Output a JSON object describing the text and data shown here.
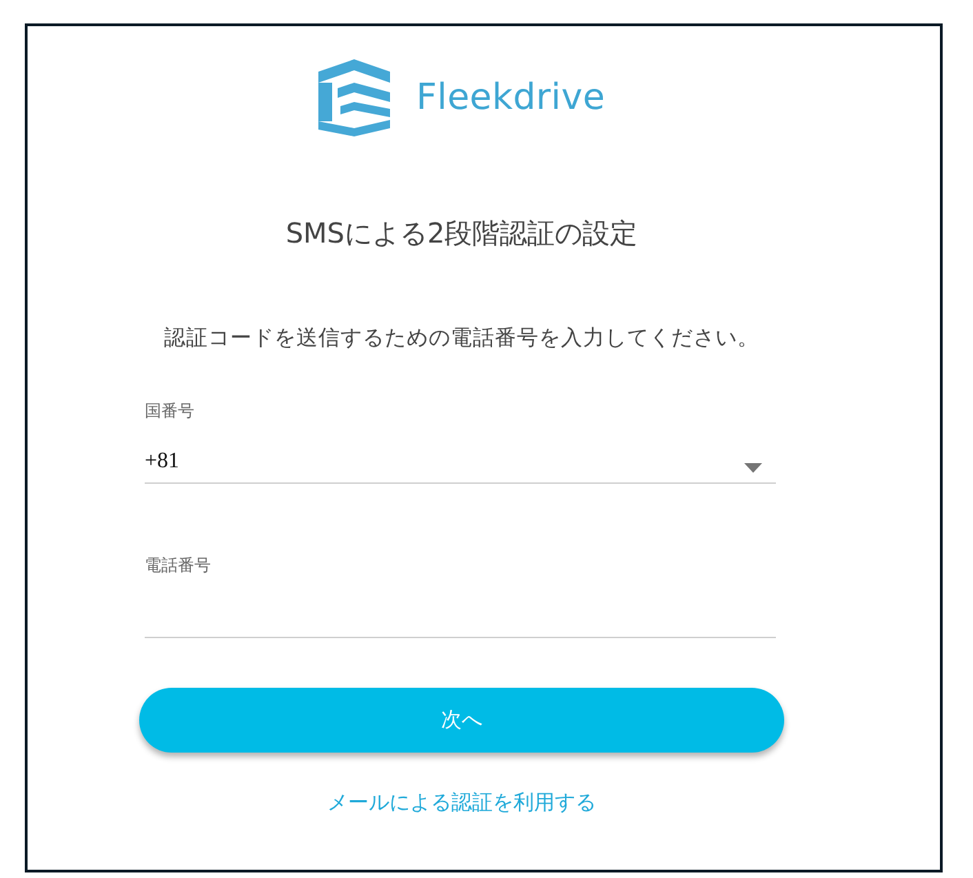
{
  "logo": {
    "name": "Fleekdrive"
  },
  "title": "SMSによる2段階認証の設定",
  "instruction": "認証コードを送信するための電話番号を入力してください。",
  "fields": [
    {
      "kind": "select",
      "label": "国番号",
      "value": "+81"
    },
    {
      "kind": "text",
      "label": "電話番号"
    }
  ],
  "next_button": {
    "label": "次へ"
  },
  "alt_link": {
    "label": "メールによる認証を利用する"
  }
}
